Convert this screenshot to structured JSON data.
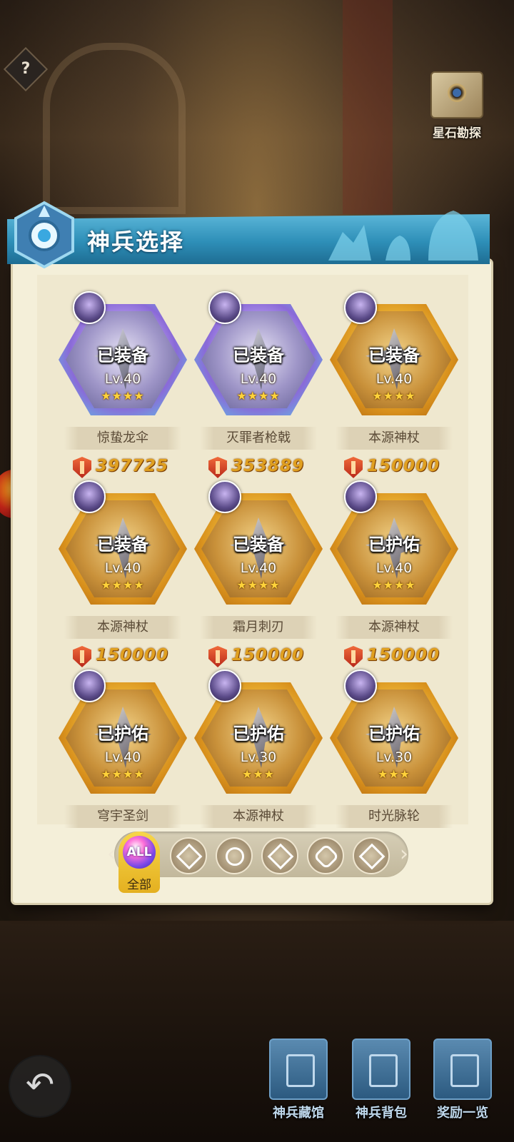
{
  "help": {
    "label": "?"
  },
  "explore": {
    "label": "星石勘探"
  },
  "panel": {
    "title": "神兵选择"
  },
  "weapons": [
    {
      "name": "惊蛰龙伞",
      "status": "已装备",
      "level": "Lv.40",
      "stars": "★★★★",
      "power": "397725",
      "frame": "purple"
    },
    {
      "name": "灭罪者枪戟",
      "status": "已装备",
      "level": "Lv.40",
      "stars": "★★★★",
      "power": "353889",
      "frame": "purple"
    },
    {
      "name": "本源神杖",
      "status": "已装备",
      "level": "Lv.40",
      "stars": "★★★★",
      "power": "150000",
      "frame": "gold"
    },
    {
      "name": "本源神杖",
      "status": "已装备",
      "level": "Lv.40",
      "stars": "★★★★",
      "power": "150000",
      "frame": "gold"
    },
    {
      "name": "霜月刺刃",
      "status": "已装备",
      "level": "Lv.40",
      "stars": "★★★★",
      "power": "150000",
      "frame": "gold"
    },
    {
      "name": "本源神杖",
      "status": "已护佑",
      "level": "Lv.40",
      "stars": "★★★★",
      "power": "150000",
      "frame": "gold"
    },
    {
      "name": "穹宇圣剑",
      "status": "已护佑",
      "level": "Lv.40",
      "stars": "★★★★",
      "power": "",
      "frame": "gold"
    },
    {
      "name": "本源神杖",
      "status": "已护佑",
      "level": "Lv.30",
      "stars": "★★★",
      "power": "",
      "frame": "gold"
    },
    {
      "name": "时光脉轮",
      "status": "已护佑",
      "level": "Lv.30",
      "stars": "★★★",
      "power": "",
      "frame": "gold"
    }
  ],
  "filter": {
    "all_icon": "ALL",
    "all_label": "全部",
    "left_arrow": "‹",
    "right_arrow": "›",
    "icons": [
      "class-icon-1",
      "class-icon-2",
      "class-icon-3",
      "class-icon-4",
      "class-icon-5"
    ]
  },
  "back": {
    "label": "↶"
  },
  "bottom_nav": [
    {
      "label": "神兵藏馆"
    },
    {
      "label": "神兵背包"
    },
    {
      "label": "奖励一览"
    }
  ]
}
